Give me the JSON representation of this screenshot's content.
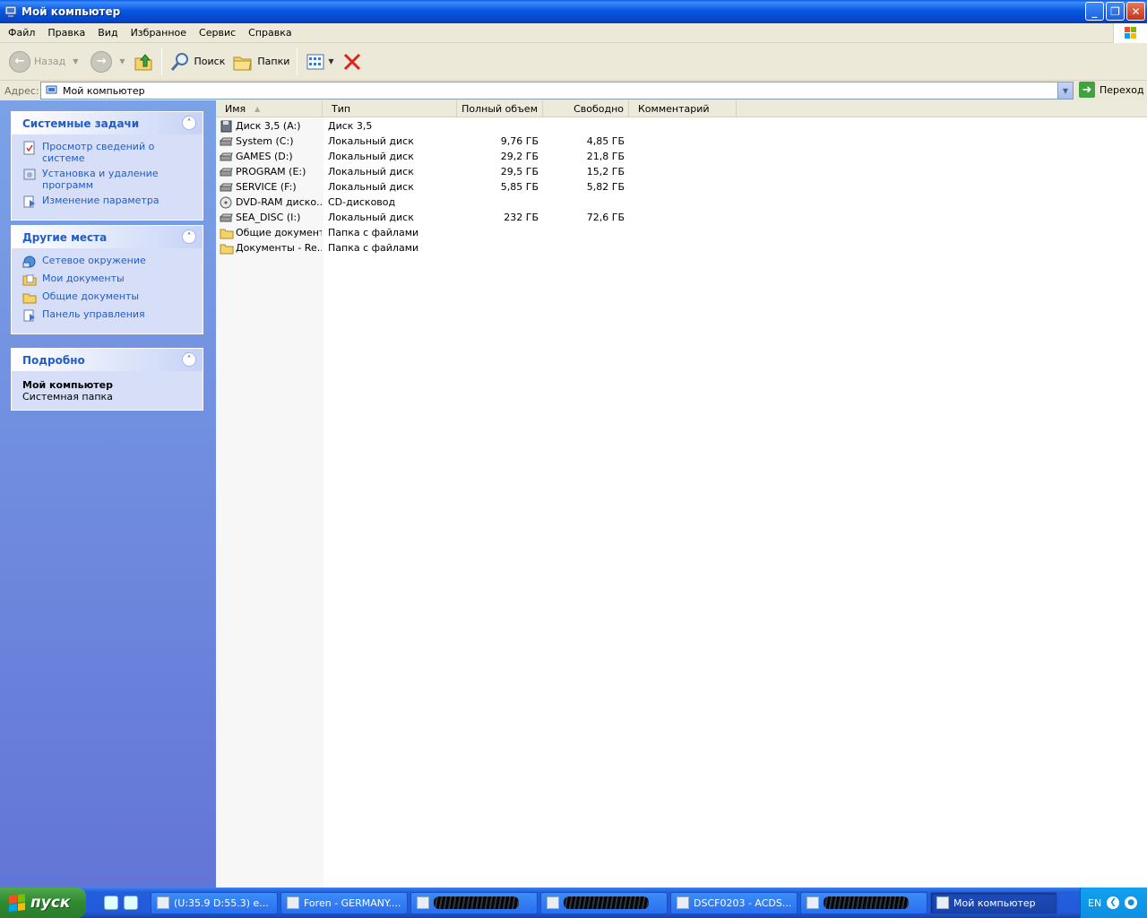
{
  "window": {
    "title": "Мой компьютер",
    "controls": {
      "minimize": "_",
      "restore": "❐",
      "close": "✕"
    }
  },
  "menu": [
    "Файл",
    "Правка",
    "Вид",
    "Избранное",
    "Сервис",
    "Справка"
  ],
  "toolbar": {
    "back_label": "Назад",
    "search_label": "Поиск",
    "folders_label": "Папки"
  },
  "address": {
    "label": "Адрес:",
    "value": "Мой компьютер",
    "go_label": "Переход"
  },
  "panels": {
    "system_tasks": {
      "title": "Системные задачи",
      "items": [
        "Просмотр сведений о системе",
        "Установка и удаление программ",
        "Изменение параметра"
      ]
    },
    "other_places": {
      "title": "Другие места",
      "items": [
        "Сетевое окружение",
        "Мои документы",
        "Общие документы",
        "Панель управления"
      ]
    },
    "details": {
      "title": "Подробно",
      "name": "Мой компьютер",
      "description": "Системная папка"
    }
  },
  "columns": {
    "name": "Имя",
    "type": "Тип",
    "total": "Полный объем",
    "free": "Свободно",
    "comment": "Комментарий"
  },
  "rows": [
    {
      "name": "Диск 3,5 (A:)",
      "type": "Диск 3,5",
      "total": "",
      "free": "",
      "icon": "floppy-icon"
    },
    {
      "name": "System (C:)",
      "type": "Локальный диск",
      "total": "9,76 ГБ",
      "free": "4,85 ГБ",
      "icon": "hard-drive-icon"
    },
    {
      "name": "GAMES (D:)",
      "type": "Локальный диск",
      "total": "29,2 ГБ",
      "free": "21,8 ГБ",
      "icon": "hard-drive-icon"
    },
    {
      "name": "PROGRAM (E:)",
      "type": "Локальный диск",
      "total": "29,5 ГБ",
      "free": "15,2 ГБ",
      "icon": "hard-drive-icon"
    },
    {
      "name": "SERVICE (F:)",
      "type": "Локальный диск",
      "total": "5,85 ГБ",
      "free": "5,82 ГБ",
      "icon": "hard-drive-icon"
    },
    {
      "name": "DVD-RAM диско...",
      "type": "CD-дисковод",
      "total": "",
      "free": "",
      "icon": "cd-drive-icon"
    },
    {
      "name": "SEA_DISC (I:)",
      "type": "Локальный диск",
      "total": "232 ГБ",
      "free": "72,6 ГБ",
      "icon": "hard-drive-icon"
    },
    {
      "name": "Общие документы",
      "type": "Папка с файлами",
      "total": "",
      "free": "",
      "icon": "folder-icon"
    },
    {
      "name": "Документы - Re...",
      "type": "Папка с файлами",
      "total": "",
      "free": "",
      "icon": "folder-icon"
    }
  ],
  "taskbar": {
    "start_label": "пуск",
    "tasks": [
      "(U:35.9 D:55.3) e...",
      "Foren - GERMANY....",
      "",
      "",
      "DSCF0203 - ACDS...",
      "",
      "Мой компьютер"
    ],
    "language": "EN"
  },
  "colors": {
    "title_bar": "#0857e0",
    "task_pane": "#7ba2e7",
    "link": "#215dc6",
    "start_button": "#3c9a3c"
  }
}
